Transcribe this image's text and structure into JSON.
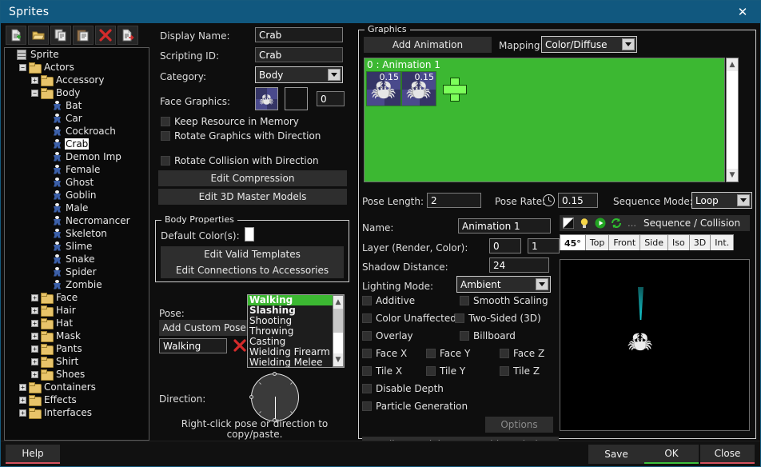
{
  "window": {
    "title": "Sprites",
    "close_icon": "close-x-icon"
  },
  "toolbar": {
    "buttons": [
      {
        "name": "new-sprite-button",
        "icon": "file-new-icon"
      },
      {
        "name": "open-button",
        "icon": "folder-open-icon"
      },
      {
        "name": "copy-button",
        "icon": "copy-icon"
      },
      {
        "name": "paste-button",
        "icon": "paste-icon"
      },
      {
        "name": "delete-button",
        "icon": "red-x-icon"
      },
      {
        "name": "export-button",
        "icon": "file-export-icon"
      }
    ]
  },
  "tree": {
    "nodes": [
      {
        "label": "Sprite",
        "depth": 0,
        "expander": "",
        "icon": "sprite-icon",
        "selected": false
      },
      {
        "label": "Actors",
        "depth": 1,
        "expander": "-",
        "icon": "folder-icon",
        "selected": false
      },
      {
        "label": "Accessory",
        "depth": 2,
        "expander": "+",
        "icon": "folder-icon",
        "selected": false
      },
      {
        "label": "Body",
        "depth": 2,
        "expander": "-",
        "icon": "folder-icon",
        "selected": false
      },
      {
        "label": "Bat",
        "depth": 3,
        "expander": "",
        "icon": "actor-icon",
        "selected": false
      },
      {
        "label": "Car",
        "depth": 3,
        "expander": "",
        "icon": "actor-icon",
        "selected": false
      },
      {
        "label": "Cockroach",
        "depth": 3,
        "expander": "",
        "icon": "actor-icon",
        "selected": false
      },
      {
        "label": "Crab",
        "depth": 3,
        "expander": "",
        "icon": "actor-icon",
        "selected": true
      },
      {
        "label": "Demon Imp",
        "depth": 3,
        "expander": "",
        "icon": "actor-icon",
        "selected": false
      },
      {
        "label": "Female",
        "depth": 3,
        "expander": "",
        "icon": "actor-icon",
        "selected": false
      },
      {
        "label": "Ghost",
        "depth": 3,
        "expander": "",
        "icon": "actor-icon",
        "selected": false
      },
      {
        "label": "Goblin",
        "depth": 3,
        "expander": "",
        "icon": "actor-icon",
        "selected": false
      },
      {
        "label": "Male",
        "depth": 3,
        "expander": "",
        "icon": "actor-icon",
        "selected": false
      },
      {
        "label": "Necromancer",
        "depth": 3,
        "expander": "",
        "icon": "actor-icon",
        "selected": false
      },
      {
        "label": "Skeleton",
        "depth": 3,
        "expander": "",
        "icon": "actor-icon",
        "selected": false
      },
      {
        "label": "Slime",
        "depth": 3,
        "expander": "",
        "icon": "actor-icon",
        "selected": false
      },
      {
        "label": "Snake",
        "depth": 3,
        "expander": "",
        "icon": "actor-icon",
        "selected": false
      },
      {
        "label": "Spider",
        "depth": 3,
        "expander": "",
        "icon": "actor-icon",
        "selected": false
      },
      {
        "label": "Zombie",
        "depth": 3,
        "expander": "",
        "icon": "actor-icon",
        "selected": false
      },
      {
        "label": "Face",
        "depth": 2,
        "expander": "+",
        "icon": "folder-icon",
        "selected": false
      },
      {
        "label": "Hair",
        "depth": 2,
        "expander": "+",
        "icon": "folder-icon",
        "selected": false
      },
      {
        "label": "Hat",
        "depth": 2,
        "expander": "+",
        "icon": "folder-icon",
        "selected": false
      },
      {
        "label": "Mask",
        "depth": 2,
        "expander": "+",
        "icon": "folder-icon",
        "selected": false
      },
      {
        "label": "Pants",
        "depth": 2,
        "expander": "+",
        "icon": "folder-icon",
        "selected": false
      },
      {
        "label": "Shirt",
        "depth": 2,
        "expander": "+",
        "icon": "folder-icon",
        "selected": false
      },
      {
        "label": "Shoes",
        "depth": 2,
        "expander": "+",
        "icon": "folder-icon",
        "selected": false
      },
      {
        "label": "Containers",
        "depth": 1,
        "expander": "+",
        "icon": "folder-icon",
        "selected": false
      },
      {
        "label": "Effects",
        "depth": 1,
        "expander": "+",
        "icon": "folder-icon",
        "selected": false
      },
      {
        "label": "Interfaces",
        "depth": 1,
        "expander": "+",
        "icon": "folder-icon",
        "selected": false
      }
    ]
  },
  "properties": {
    "display_name_label": "Display Name:",
    "display_name_value": "Crab",
    "scripting_id_label": "Scripting ID:",
    "scripting_id_value": "Crab",
    "category_label": "Category:",
    "category_value": "Body",
    "face_graphics_label": "Face Graphics:",
    "face_graphics_index": "0",
    "keep_resource_label": "Keep Resource in Memory",
    "rotate_graphics_label": "Rotate Graphics with Direction",
    "rotate_collision_label": "Rotate Collision with Direction",
    "edit_compression_label": "Edit Compression",
    "edit_3d_master_label": "Edit 3D Master Models"
  },
  "body_properties": {
    "title": "Body Properties",
    "default_colors_label": "Default Color(s):",
    "edit_valid_templates_label": "Edit Valid Templates",
    "edit_connections_label": "Edit Connections to Accessories"
  },
  "pose": {
    "label": "Pose:",
    "add_custom_pose_label": "Add Custom Pose",
    "current_value": "Walking",
    "delete_icon": "red-x-icon",
    "items": [
      {
        "label": "Walking",
        "selected": true,
        "bold": true
      },
      {
        "label": "Slashing",
        "selected": false,
        "bold": true
      },
      {
        "label": "Shooting",
        "selected": false,
        "bold": false
      },
      {
        "label": "Throwing",
        "selected": false,
        "bold": false
      },
      {
        "label": "Casting",
        "selected": false,
        "bold": false
      },
      {
        "label": "Wielding Firearm",
        "selected": false,
        "bold": false
      },
      {
        "label": "Wielding Melee",
        "selected": false,
        "bold": false
      }
    ],
    "direction_label": "Direction:",
    "hint_line1": "Right-click pose or direction to",
    "hint_line2": "copy/paste."
  },
  "graphics": {
    "title": "Graphics",
    "add_animation_label": "Add Animation",
    "mapping_label": "Mapping:",
    "mapping_value": "Color/Diffuse",
    "animation_row_label": "0 : Animation 1",
    "frames": [
      {
        "duration": "0.15",
        "icon": "crab-sprite-icon"
      },
      {
        "duration": "0.15",
        "icon": "crab-sprite-icon"
      }
    ],
    "add_frame_icon": "green-plus-icon",
    "pose_length_label": "Pose Length:",
    "pose_length_value": "2",
    "pose_rate_label": "Pose Rate:",
    "pose_rate_icon": "clock-icon",
    "pose_rate_value": "0.15",
    "sequence_mode_label": "Sequence Mode:",
    "sequence_mode_value": "Loop",
    "name_label": "Name:",
    "name_value": "Animation 1",
    "layer_label": "Layer (Render, Color):",
    "layer_render_value": "0",
    "layer_color_value": "1",
    "shadow_distance_label": "Shadow Distance:",
    "shadow_distance_value": "24",
    "lighting_mode_label": "Lighting Mode:",
    "lighting_mode_value": "Ambient",
    "checkboxes": [
      {
        "label": "Additive",
        "checked": false
      },
      {
        "label": "Smooth Scaling",
        "checked": false
      },
      {
        "label": "Color Unaffected",
        "checked": false
      },
      {
        "label": "Two-Sided (3D)",
        "checked": false
      },
      {
        "label": "Overlay",
        "checked": false
      },
      {
        "label": "Billboard",
        "checked": false
      },
      {
        "label": "Face X",
        "checked": false
      },
      {
        "label": "Face Y",
        "checked": false
      },
      {
        "label": "Face Z",
        "checked": false
      },
      {
        "label": "Tile X",
        "checked": false
      },
      {
        "label": "Tile Y",
        "checked": false
      },
      {
        "label": "Tile Z",
        "checked": false
      },
      {
        "label": "Disable Depth",
        "checked": false
      },
      {
        "label": "Particle Generation",
        "checked": false
      }
    ],
    "options_label": "Options",
    "edit_material_label": "Edit Material",
    "graphic_scripting_label": "Graphic Scripting"
  },
  "preview": {
    "sequence_collision_label": "Sequence / Collision",
    "toolbar_icons": [
      {
        "name": "contrast-icon"
      },
      {
        "name": "lightbulb-icon"
      },
      {
        "name": "play-icon"
      },
      {
        "name": "loop-icon"
      },
      {
        "name": "more-dots-icon"
      }
    ],
    "tabs": [
      {
        "label": "45°",
        "active": true
      },
      {
        "label": "Top",
        "active": false
      },
      {
        "label": "Front",
        "active": false
      },
      {
        "label": "Side",
        "active": false
      },
      {
        "label": "Iso",
        "active": false
      },
      {
        "label": "3D",
        "active": false
      },
      {
        "label": "Int.",
        "active": false
      }
    ]
  },
  "footer": {
    "help_label": "Help",
    "save_label": "Save",
    "ok_label": "OK",
    "close_label": "Close"
  },
  "colors": {
    "title_bar": "#11587f",
    "accent_green": "#3cb832",
    "ok_underline": "#3ec13e",
    "danger_red": "#d4525f"
  }
}
